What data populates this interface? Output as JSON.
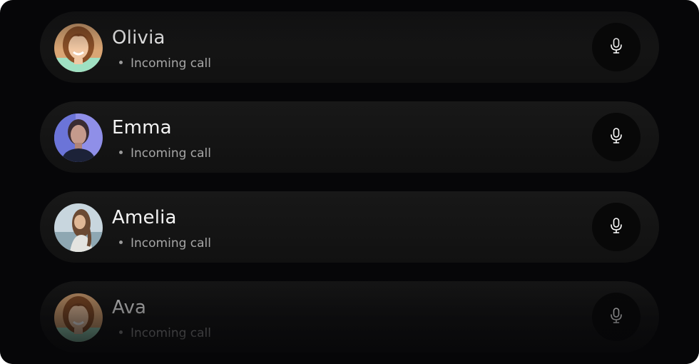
{
  "calls": [
    {
      "name": "Olivia",
      "status": "Incoming call",
      "avatar": "woman-smiling-orange-avatar",
      "mic_icon": "microphone-icon"
    },
    {
      "name": "Emma",
      "status": "Incoming call",
      "avatar": "woman-blue-portrait-avatar",
      "mic_icon": "microphone-icon"
    },
    {
      "name": "Amelia",
      "status": "Incoming call",
      "avatar": "woman-outdoor-sky-avatar",
      "mic_icon": "microphone-icon"
    },
    {
      "name": "Ava",
      "status": "Incoming call",
      "avatar": "woman-smiling-orange-avatar",
      "mic_icon": "microphone-icon"
    }
  ],
  "colors": {
    "background": "#060608",
    "card": "#151515",
    "name_text": "#f4f4f4",
    "status_text": "#a6a6a6",
    "mic_button": "#080808"
  }
}
